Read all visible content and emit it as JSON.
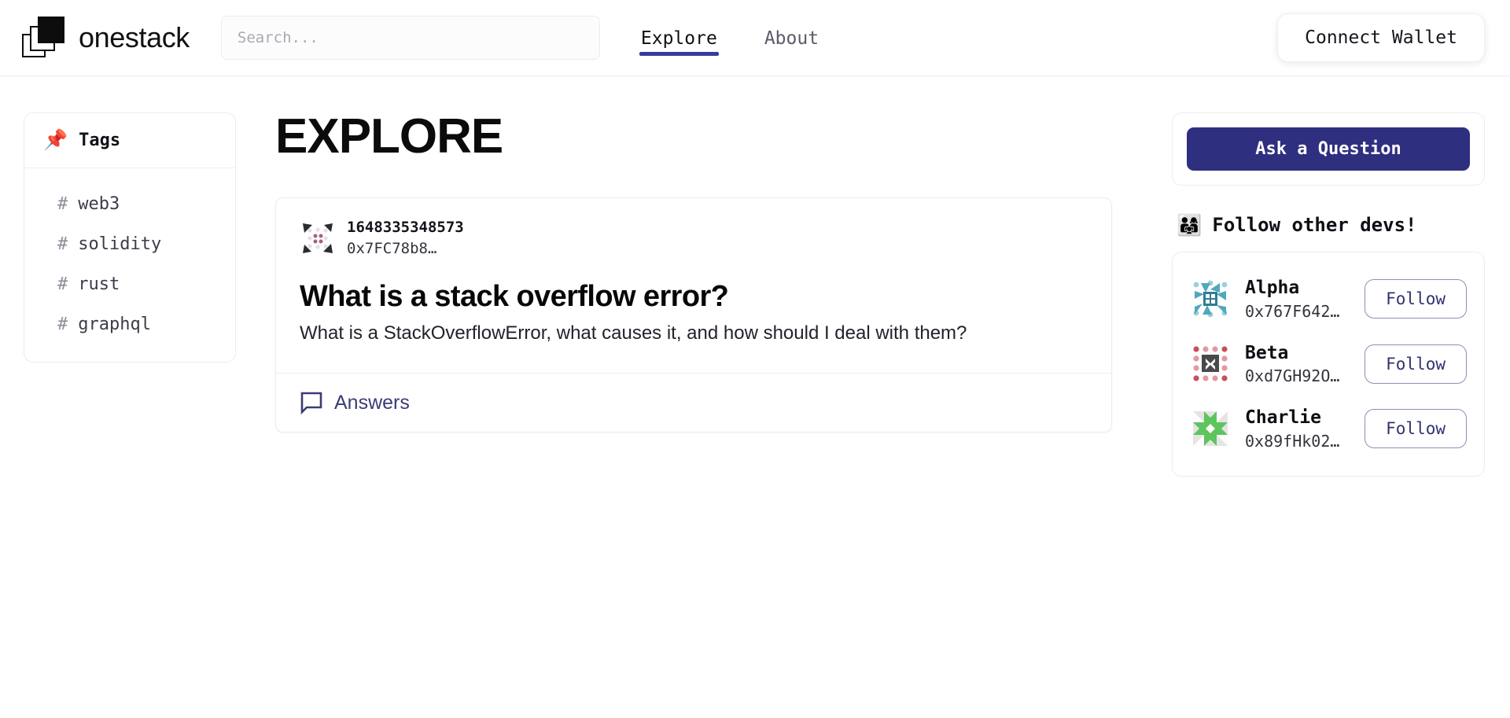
{
  "header": {
    "brand_name": "onestack",
    "logo_icon": "stacked-squares-logo",
    "search": {
      "placeholder": "Search...",
      "value": ""
    },
    "nav": [
      {
        "label": "Explore",
        "active": true
      },
      {
        "label": "About",
        "active": false
      }
    ],
    "connect_wallet_label": "Connect Wallet"
  },
  "sidebar": {
    "tags_emoji": "📌",
    "tags_title": "Tags",
    "tags": [
      {
        "hash": "#",
        "label": "web3"
      },
      {
        "hash": "#",
        "label": "solidity"
      },
      {
        "hash": "#",
        "label": "rust"
      },
      {
        "hash": "#",
        "label": "graphql"
      }
    ]
  },
  "main": {
    "page_title": "EXPLORE",
    "questions": [
      {
        "author_id": "1648335348573",
        "author_address": "0x7FC78b8…",
        "avatar_icon": "identicon-avatar",
        "title": "What is a stack overflow error?",
        "excerpt": "What is a StackOverflowError, what causes it, and how should I deal with them?",
        "answers_label": "Answers",
        "answers_icon": "speech-bubble-icon"
      }
    ]
  },
  "right": {
    "ask_question_label": "Ask a Question",
    "follow_emoji": "👨‍👩‍👧",
    "follow_title": "Follow other devs!",
    "devs": [
      {
        "name": "Alpha",
        "address": "0x767F642…",
        "follow_label": "Follow",
        "avatar_icon": "identicon-avatar-teal"
      },
      {
        "name": "Beta",
        "address": "0xd7GH92O…",
        "follow_label": "Follow",
        "avatar_icon": "identicon-avatar-red"
      },
      {
        "name": "Charlie",
        "address": "0x89fHk02…",
        "follow_label": "Follow",
        "avatar_icon": "identicon-avatar-green"
      }
    ]
  },
  "colors": {
    "accent_indigo": "#2f2f80",
    "nav_underline": "#383a9e",
    "text_primary": "#0b0b0d",
    "text_muted": "#5b5b6b",
    "border": "#ececef"
  }
}
